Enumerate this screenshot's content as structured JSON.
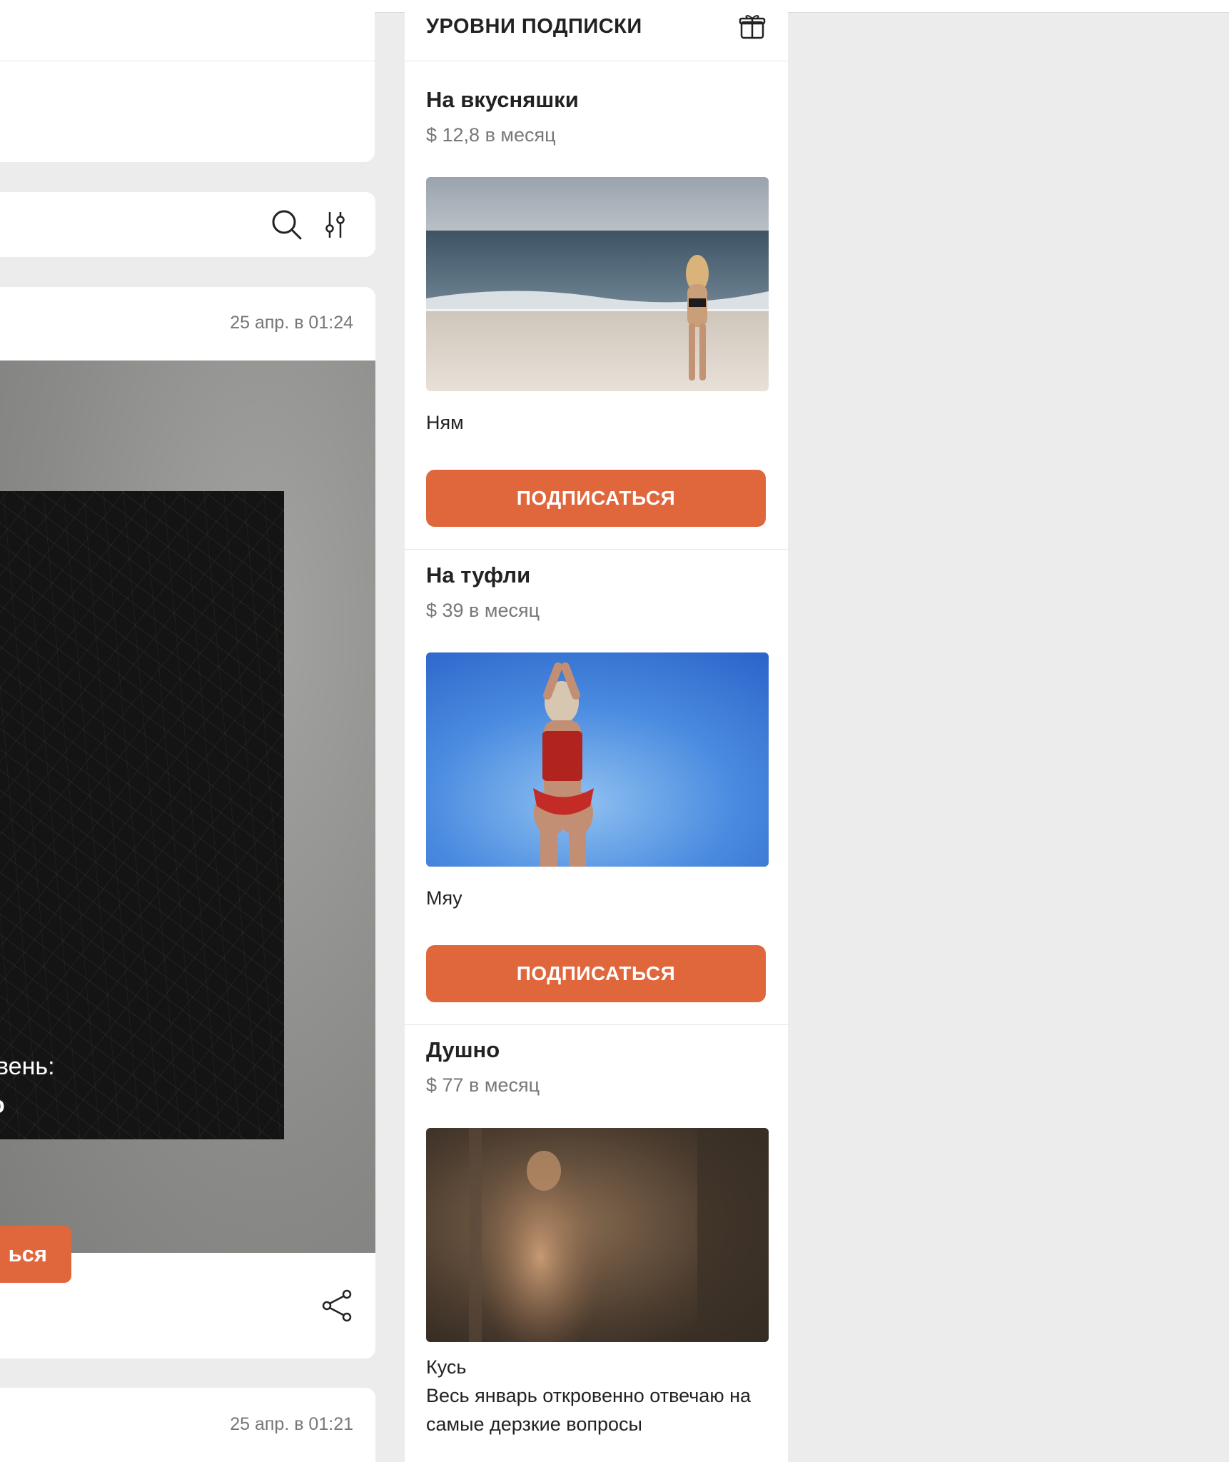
{
  "feed": {
    "posts": [
      {
        "date": "25 апр. в 01:24",
        "locked_line1": "вень:",
        "locked_line2": "о",
        "locked_button": "ься"
      },
      {
        "date": "25 апр. в 01:21"
      }
    ]
  },
  "tiers": {
    "title": "УРОВНИ ПОДПИСКИ",
    "items": [
      {
        "name": "На вкусняшки",
        "price": "$ 12,8 в месяц",
        "description": "Ням",
        "button": "ПОДПИСАТЬСЯ"
      },
      {
        "name": "На туфли",
        "price": "$ 39 в месяц",
        "description": "Мяу",
        "button": "ПОДПИСАТЬСЯ"
      },
      {
        "name": "Душно",
        "price": "$ 77 в месяц",
        "description": "Кусь\nВесь январь откровенно отвечаю на самые дерзкие вопросы"
      }
    ]
  },
  "colors": {
    "accent": "#e0673c",
    "background": "#ececec",
    "card": "#ffffff"
  }
}
